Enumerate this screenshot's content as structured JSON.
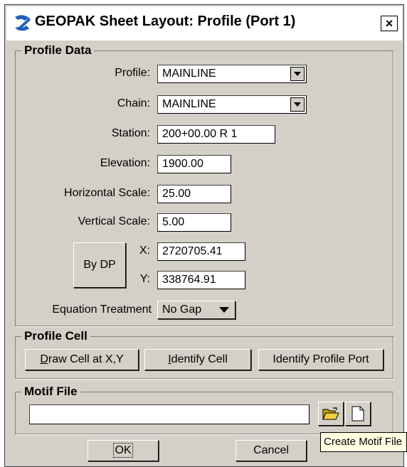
{
  "window": {
    "title": "GEOPAK Sheet Layout: Profile (Port 1)",
    "close_label": "×"
  },
  "profile_data": {
    "legend": "Profile Data",
    "profile_label": "Profile:",
    "profile_value": "MAINLINE",
    "chain_label": "Chain:",
    "chain_value": "MAINLINE",
    "station_label": "Station:",
    "station_value": "200+00.00 R 1",
    "elevation_label": "Elevation:",
    "elevation_value": "1900.00",
    "hscale_label": "Horizontal Scale:",
    "hscale_value": "25.00",
    "vscale_label": "Vertical Scale:",
    "vscale_value": "5.00",
    "bydp_label": "By DP",
    "x_label": "X:",
    "x_value": "2720705.41",
    "y_label": "Y:",
    "y_value": "338764.91",
    "equation_label": "Equation Treatment",
    "equation_value": "No Gap"
  },
  "profile_cell": {
    "legend": "Profile Cell",
    "draw_cell_underline": "D",
    "draw_cell_rest": "raw Cell at X,Y",
    "identify_cell_underline": "I",
    "identify_cell_rest": "dentify Cell",
    "identify_port_label": "Identify Profile Port"
  },
  "motif_file": {
    "legend": "Motif File",
    "value": ""
  },
  "footer": {
    "ok_label": "OK",
    "cancel_label": "Cancel"
  },
  "tooltip": {
    "text": "Create Motif File"
  }
}
